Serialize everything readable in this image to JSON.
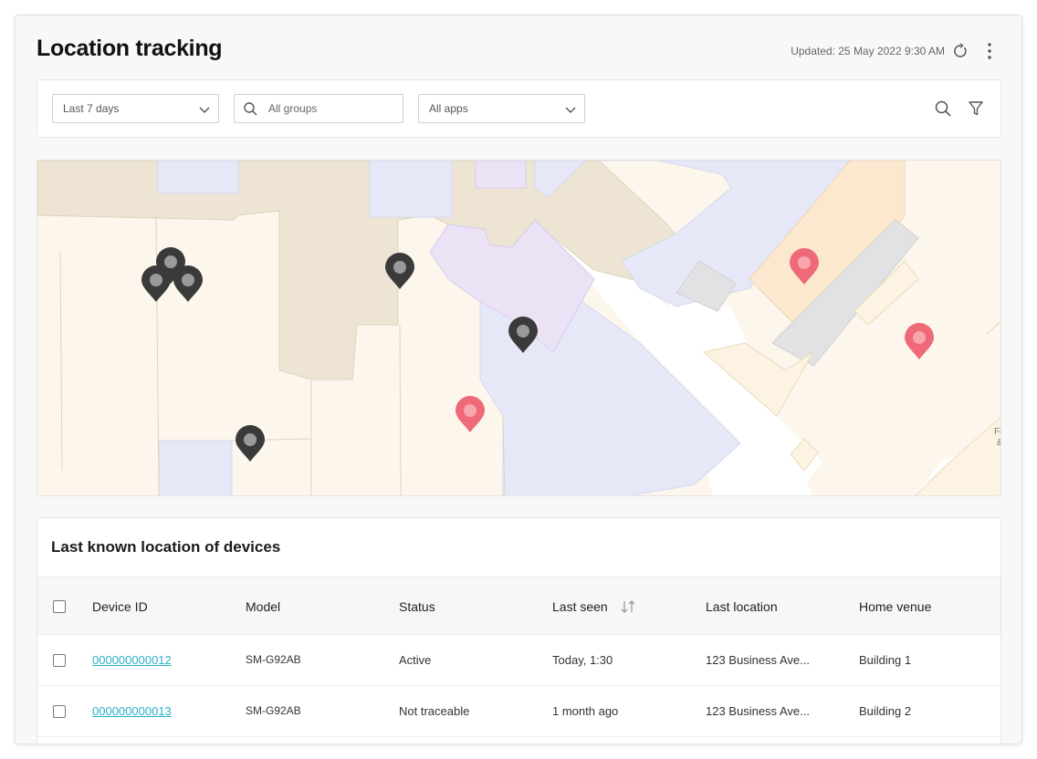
{
  "header": {
    "title": "Location tracking",
    "updated": "Updated: 25 May 2022  9:30 AM",
    "refresh_icon": "refresh-icon",
    "more_icon": "more-vertical-icon"
  },
  "filters": {
    "date_range": "Last 7 days",
    "groups_placeholder": "All groups",
    "apps": "All apps",
    "search_icon": "search-icon",
    "filter_icon": "filter-icon"
  },
  "map": {
    "marker_colors": {
      "device": "#3a3a3a",
      "venue": "#ee6a78"
    },
    "partial_label": "Fi\n&"
  },
  "table": {
    "title": "Last known location of devices",
    "columns": [
      "Device ID",
      "Model",
      "Status",
      "Last seen",
      "Last location",
      "Home venue"
    ],
    "rows": [
      {
        "device_id": "000000000012",
        "model": "SM-G92AB",
        "status": "Active",
        "last_seen": "Today, 1:30",
        "last_location": "123 Business Ave...",
        "home_venue": "Building 1"
      },
      {
        "device_id": "000000000013",
        "model": "SM-G92AB",
        "status": "Not traceable",
        "last_seen": "1 month ago",
        "last_location": "123 Business Ave...",
        "home_venue": "Building 2"
      }
    ]
  },
  "colors": {
    "accent_link": "#2ab0c8"
  }
}
